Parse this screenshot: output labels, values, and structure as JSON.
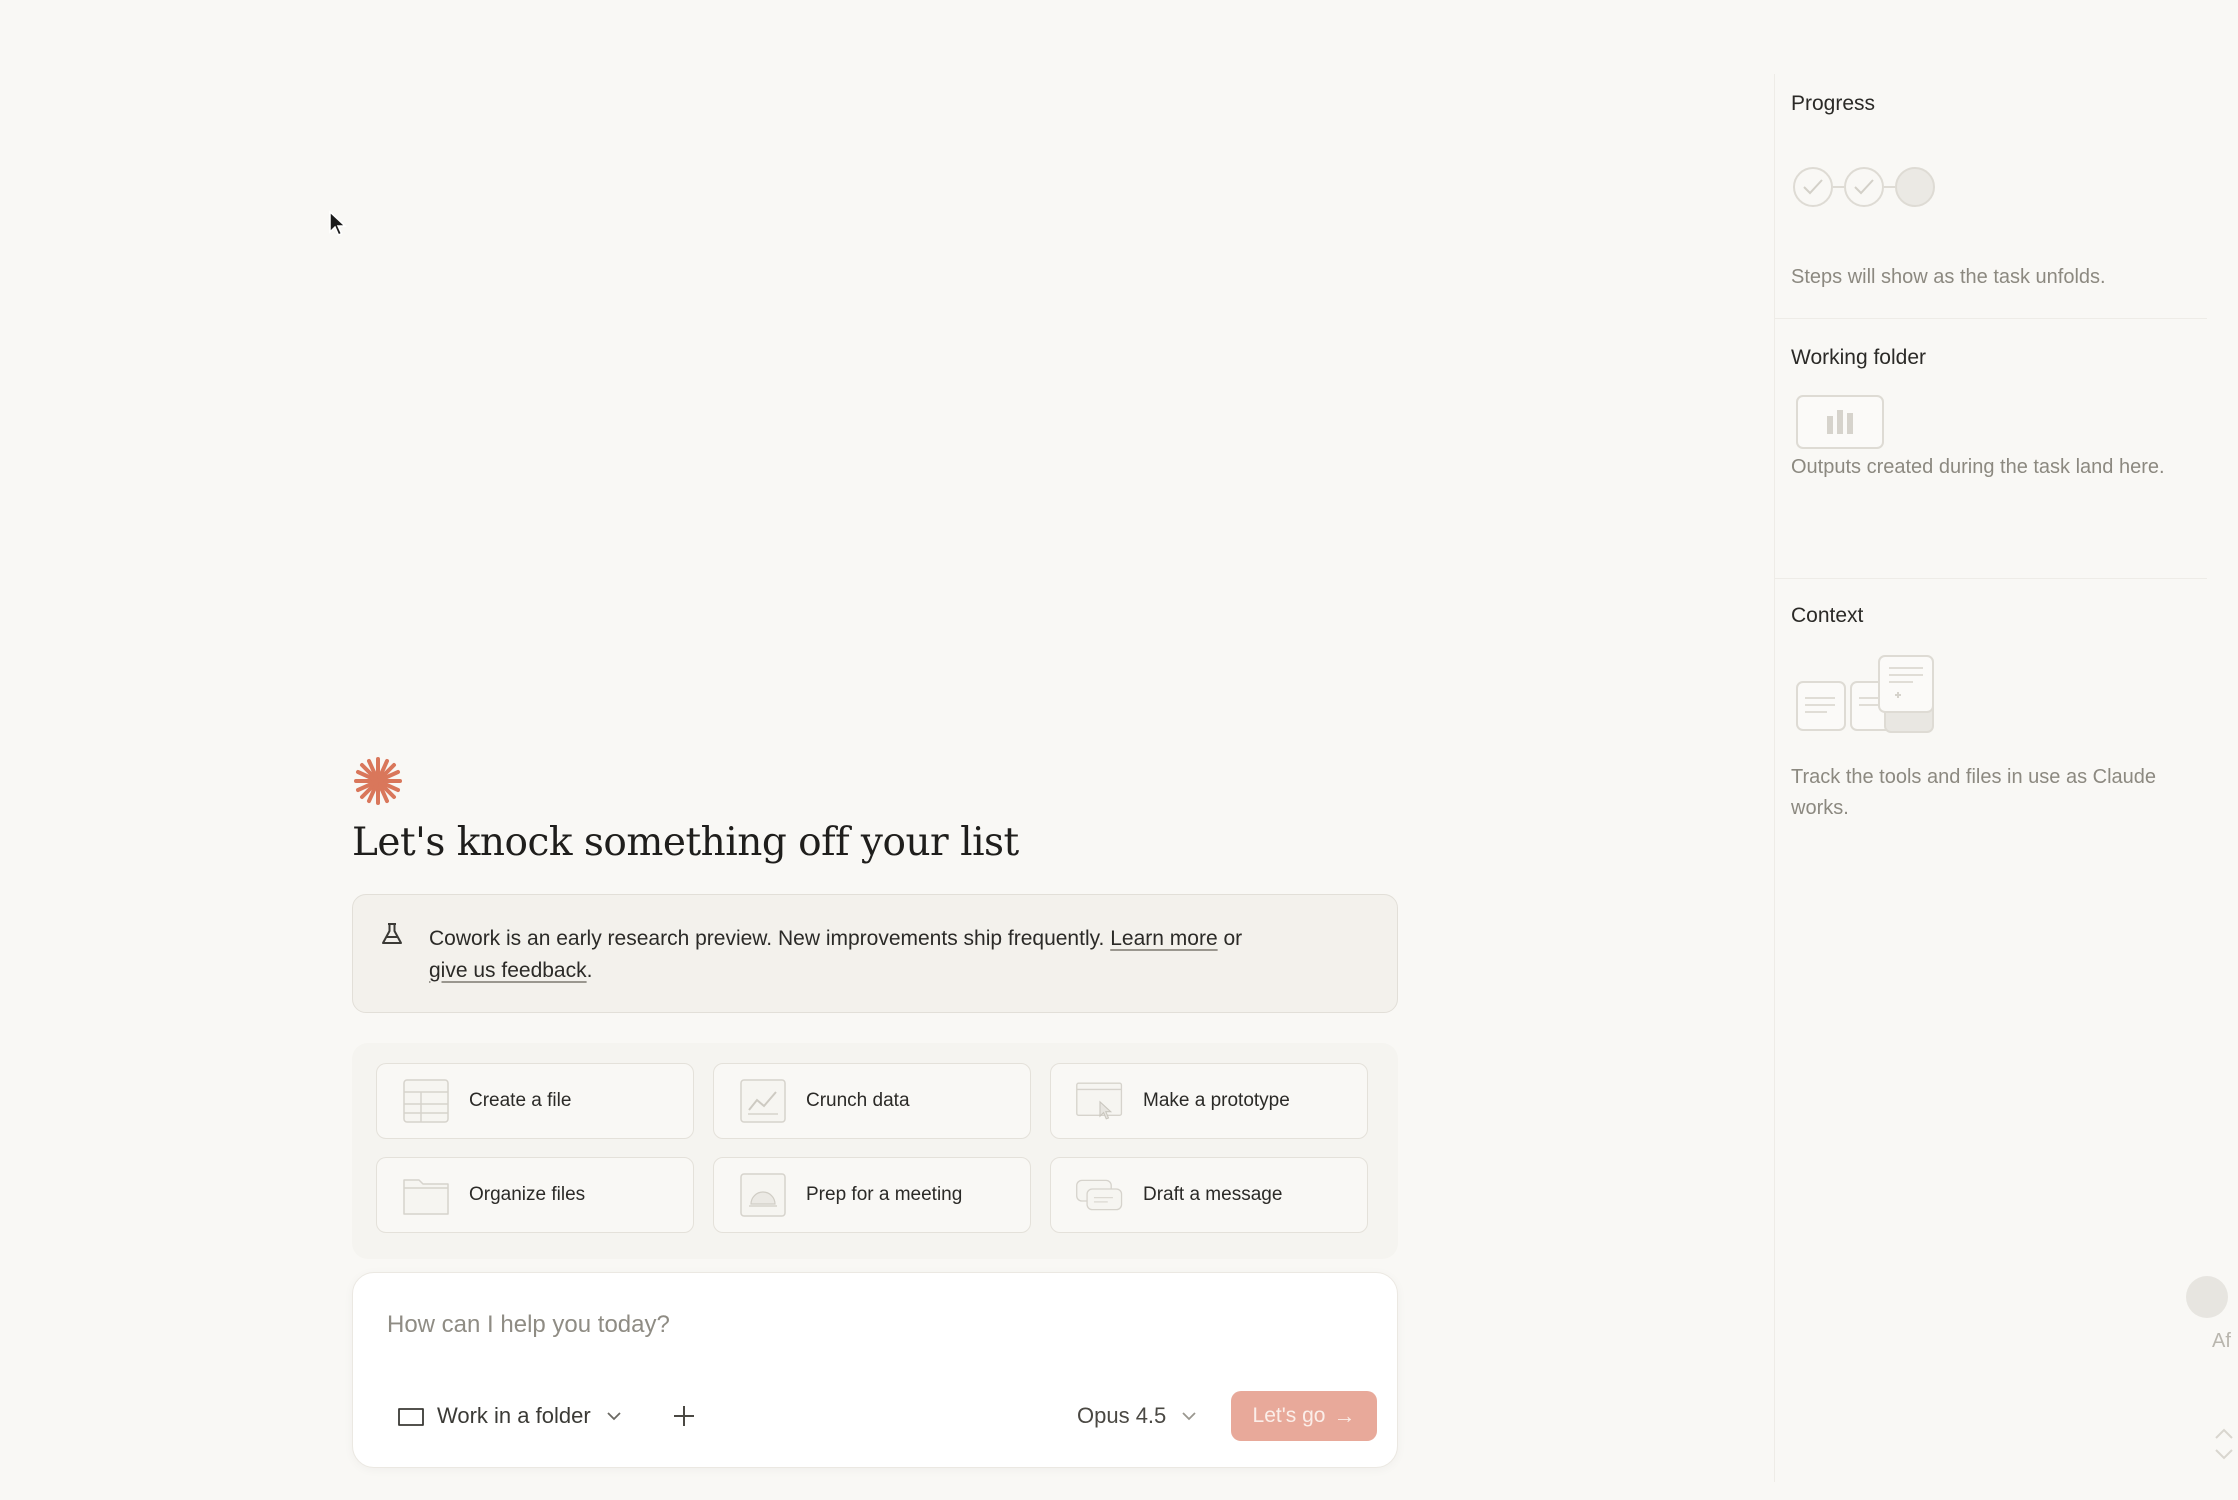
{
  "main": {
    "headline": "Let's knock something off your list",
    "notice": {
      "text": "Cowork is an early research preview. New improvements ship frequently.",
      "learn_more": "Learn more",
      "or": "or",
      "feedback": "give us feedback",
      "period": "."
    },
    "actions": [
      {
        "label": "Create a file",
        "icon": "file-grid-icon"
      },
      {
        "label": "Crunch data",
        "icon": "chart-icon"
      },
      {
        "label": "Make a prototype",
        "icon": "prototype-icon"
      },
      {
        "label": "Organize files",
        "icon": "folder-icon"
      },
      {
        "label": "Prep for a meeting",
        "icon": "meeting-icon"
      },
      {
        "label": "Draft a message",
        "icon": "message-icon"
      }
    ],
    "composer": {
      "placeholder": "How can I help you today?",
      "folder_label": "Work in a folder",
      "model_label": "Opus 4.5",
      "go_label": "Let's go",
      "go_arrow": "→"
    }
  },
  "panel": {
    "progress": {
      "title": "Progress",
      "description": "Steps will show as the task unfolds."
    },
    "working_folder": {
      "title": "Working folder",
      "description": "Outputs created during the task land here."
    },
    "context": {
      "title": "Context",
      "description": "Track the tools and files in use as Claude works."
    },
    "edge_label": "Af"
  },
  "colors": {
    "accent": "#d9775b",
    "go_button": "#e8a99a",
    "background": "#f9f8f5"
  }
}
